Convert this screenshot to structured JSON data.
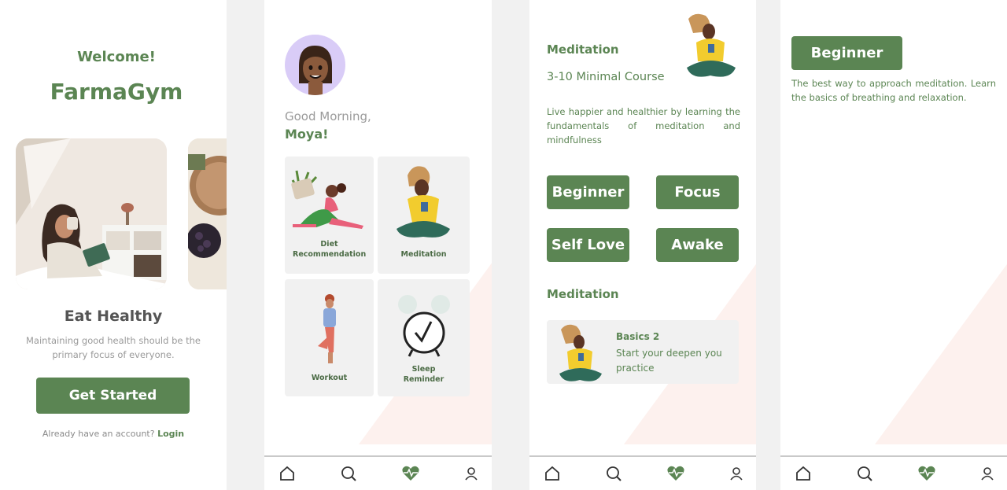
{
  "welcome": {
    "greeting": "Welcome!",
    "app_name": "FarmaGym",
    "title": "Eat Healthy",
    "description": "Maintaining good health should be the primary focus of everyone.",
    "cta_label": "Get Started",
    "account_prompt": "Already have an account?",
    "login_label": "Login"
  },
  "home": {
    "greeting": "Good Morning,",
    "user_name": "Moya!",
    "cards": [
      {
        "label": "Diet Recommendation"
      },
      {
        "label": "Meditation"
      },
      {
        "label": "Workout"
      },
      {
        "label": "Sleep Reminder"
      }
    ]
  },
  "meditation": {
    "title": "Meditation",
    "subtitle": "3-10 Minimal Course",
    "description": "Live happier and healthier by learning the fundamentals of meditation and mindfulness",
    "chips": [
      "Beginner",
      "Focus",
      "Self Love",
      "Awake"
    ],
    "section_title": "Meditation",
    "course": {
      "title": "Basics 2",
      "description": "Start your deepen you practice"
    }
  },
  "beginner": {
    "button_label": "Beginner",
    "description": "The best way to approach meditation. Learn the basics of breathing and relaxation."
  },
  "tabbar": {
    "icons": [
      "home-icon",
      "search-icon",
      "heartbeat-icon",
      "profile-icon"
    ]
  },
  "colors": {
    "accent": "#5b8553",
    "card_bg": "#f1f1f1",
    "background_shape": "#fdf1ee"
  }
}
